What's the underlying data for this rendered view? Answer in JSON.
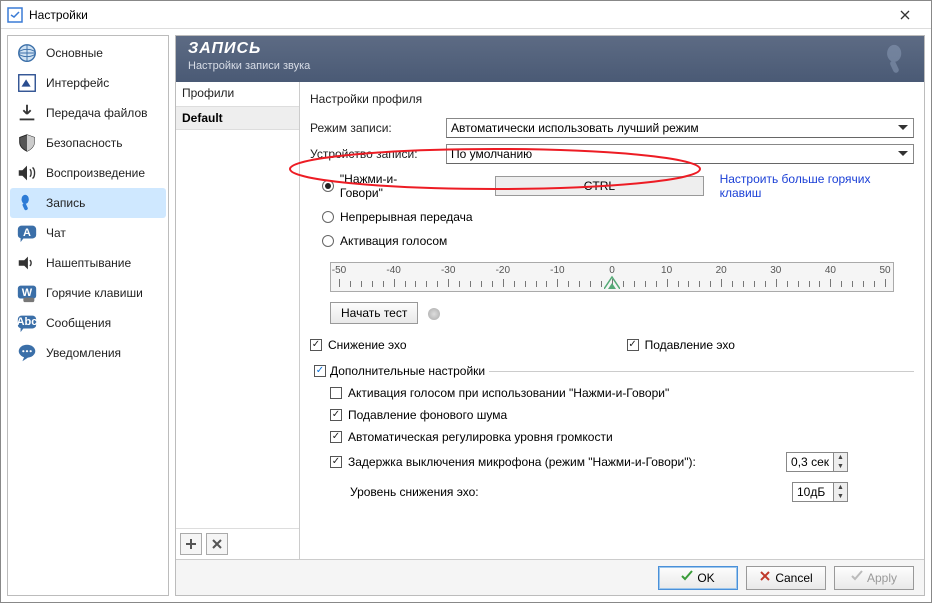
{
  "window": {
    "title": "Настройки"
  },
  "sidebar": {
    "items": [
      {
        "label": "Основные"
      },
      {
        "label": "Интерфейс"
      },
      {
        "label": "Передача файлов"
      },
      {
        "label": "Безопасность"
      },
      {
        "label": "Воспроизведение"
      },
      {
        "label": "Запись"
      },
      {
        "label": "Чат"
      },
      {
        "label": "Нашептывание"
      },
      {
        "label": "Горячие клавиши"
      },
      {
        "label": "Сообщения"
      },
      {
        "label": "Уведомления"
      }
    ]
  },
  "header": {
    "title": "ЗАПИСЬ",
    "subtitle": "Настройки записи звука"
  },
  "profiles": {
    "heading": "Профили",
    "items": [
      "Default"
    ]
  },
  "settings": {
    "heading": "Настройки профиля",
    "mode_label": "Режим записи:",
    "mode_value": "Автоматически использовать лучший режим",
    "device_label": "Устройство записи:",
    "device_value": "По умолчанию",
    "radio_ptt": "\"Нажми-и-Говори\"",
    "hotkey": "CTRL",
    "more_hotkeys_link": "Настроить больше горячих клавиш",
    "radio_continuous": "Непрерывная передача",
    "radio_vad": "Активация голосом",
    "ruler_ticks": [
      "-50",
      "-40",
      "-30",
      "-20",
      "-10",
      "0",
      "10",
      "20",
      "30",
      "40",
      "50"
    ],
    "start_test": "Начать тест",
    "echo_reduce": "Снижение эхо",
    "echo_cancel": "Подавление эхо",
    "addl_legend": "Дополнительные настройки",
    "vad_with_ptt": "Активация голосом при использовании \"Нажми-и-Говори\"",
    "denoise": "Подавление фонового шума",
    "agc": "Автоматическая регулировка уровня громкости",
    "ptt_delay": "Задержка выключения микрофона (режим \"Нажми-и-Говори\"):",
    "ptt_delay_val": "0,3 сек",
    "echo_level_label": "Уровень снижения эхо:",
    "echo_level_val": "10дБ"
  },
  "footer": {
    "ok": "OK",
    "cancel": "Cancel",
    "apply": "Apply"
  }
}
